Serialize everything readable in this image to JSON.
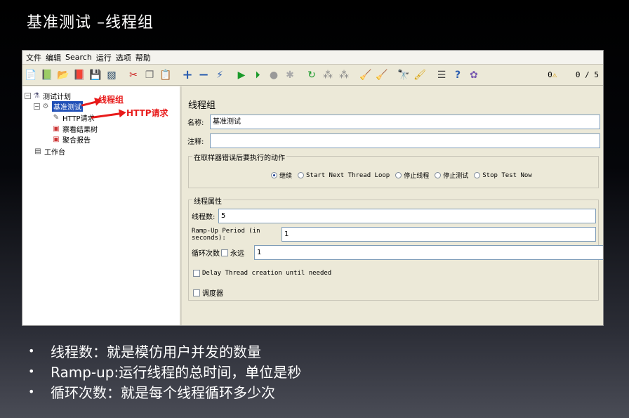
{
  "slide": {
    "title": "基准测试 –线程组"
  },
  "menubar": {
    "items": [
      "文件",
      "编辑",
      "Search",
      "运行",
      "选项",
      "帮助"
    ]
  },
  "toolbar": {
    "icons": [
      "new-icon",
      "templates-icon",
      "open-icon",
      "close-icon",
      "save-icon",
      "save-as-icon",
      "cut-icon",
      "copy-icon",
      "paste-icon",
      "expand-icon",
      "collapse-icon",
      "toggle-icon",
      "start-icon",
      "start-no-pause-icon",
      "stop-icon",
      "shutdown-icon",
      "remote-start-icon",
      "remote-stop-icon",
      "remote-shutdown-icon",
      "clear-icon",
      "clear-all-icon",
      "search-icon",
      "reset-search-icon",
      "function-helper-icon",
      "help-icon",
      "logger-icon"
    ],
    "warnings": "0",
    "threads": "0 / 5"
  },
  "tree": {
    "test_plan": "测试计划",
    "thread_group": "基准测试",
    "http_request": "HTTP请求",
    "view_results": "察看结果树",
    "aggregate_report": "聚合报告",
    "workbench": "工作台"
  },
  "annotations": {
    "thread_group": "线程组",
    "http_request": "HTTP请求"
  },
  "panel": {
    "title": "线程组",
    "name_label": "名称:",
    "name_value": "基准测试",
    "comment_label": "注释:",
    "comment_value": "",
    "error_action": {
      "legend": "在取样器错误后要执行的动作",
      "options": [
        "继续",
        "Start Next Thread Loop",
        "停止线程",
        "停止测试",
        "Stop Test Now"
      ],
      "selected": "继续"
    },
    "thread_props": {
      "legend": "线程属性",
      "threads_label": "线程数:",
      "threads_value": "5",
      "rampup_label": "Ramp-Up Period (in seconds):",
      "rampup_value": "1",
      "loop_label": "循环次数",
      "forever_label": "永远",
      "loop_value": "1",
      "delay_label": "Delay Thread creation until needed",
      "scheduler_label": "调度器"
    }
  },
  "bullets": [
    "线程数：就是模仿用户并发的数量",
    "Ramp-up:运行线程的总时间，单位是秒",
    "循环次数：就是每个线程循环多少次"
  ]
}
